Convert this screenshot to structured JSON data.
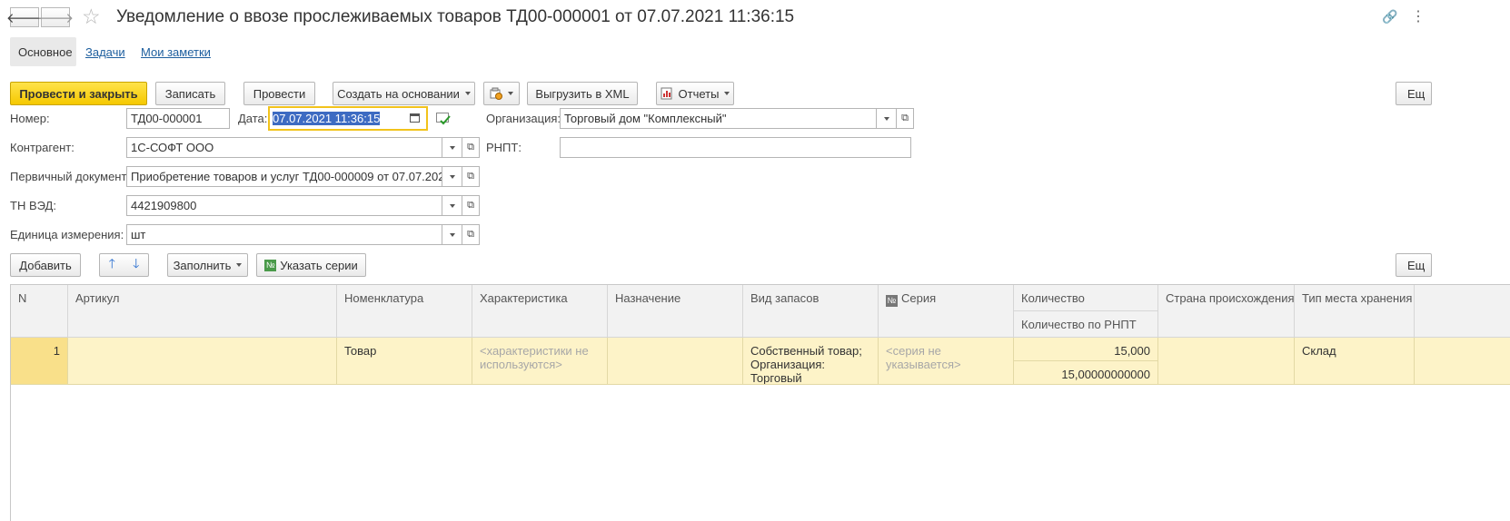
{
  "window": {
    "title": "Уведомление о ввозе прослеживаемых товаров ТД00-000001 от 07.07.2021 11:36:15",
    "back_glyph": "🡐",
    "forward_glyph": "🡒",
    "star_glyph": "☆",
    "link_glyph": "🔗",
    "more_glyph": "⋮"
  },
  "tabs": [
    {
      "label": "Основное"
    },
    {
      "label": "Задачи"
    },
    {
      "label": "Мои заметки"
    }
  ],
  "toolbar": {
    "post_close": "Провести и закрыть",
    "save": "Записать",
    "post": "Провести",
    "create_based": "Создать на основании",
    "export_xml": "Выгрузить в XML",
    "reports": "Отчеты",
    "more": "Ещ"
  },
  "form": {
    "number_label": "Номер:",
    "number_value": "ТД00-000001",
    "date_label": "Дата:",
    "date_value": "07.07.2021 11:36:15",
    "org_label": "Организация:",
    "org_value": "Торговый дом \"Комплексный\"",
    "contractor_label": "Контрагент:",
    "contractor_value": "1С-СОФТ ООО",
    "rnpt_label": "РНПТ:",
    "rnpt_value": "",
    "primary_label": "Первичный документ:",
    "primary_value": "Приобретение товаров и услуг ТД00-000009 от 07.07.2021 11:",
    "tnved_label": "ТН ВЭД:",
    "tnved_value": "4421909800",
    "unit_label": "Единица измерения:",
    "unit_value": "шт"
  },
  "table_toolbar": {
    "add": "Добавить",
    "up_glyph": "🡑",
    "down_glyph": "🡓",
    "fill": "Заполнить",
    "series_icon": "№",
    "specify_series": "Указать серии",
    "more": "Ещ"
  },
  "table": {
    "columns": {
      "n": "N",
      "article": "Артикул",
      "nomenclature": "Номенклатура",
      "characteristic": "Характеристика",
      "purpose": "Назначение",
      "stock_type": "Вид запасов",
      "series_icon": "№",
      "series": "Серия",
      "quantity": "Количество",
      "quantity_rnpt": "Количество по РНПТ",
      "country": "Страна происхождения",
      "storage_type": "Тип места хранения"
    },
    "rows": [
      {
        "n": "1",
        "article": "",
        "nomenclature": "Товар",
        "characteristic": "<характеристики не используются>",
        "purpose": "",
        "stock_type": "Собственный товар; Организация: Торговый",
        "series": "<серия не указывается>",
        "quantity": "15,000",
        "quantity_rnpt": "15,00000000000",
        "country": "",
        "storage_type": "Склад"
      }
    ]
  }
}
